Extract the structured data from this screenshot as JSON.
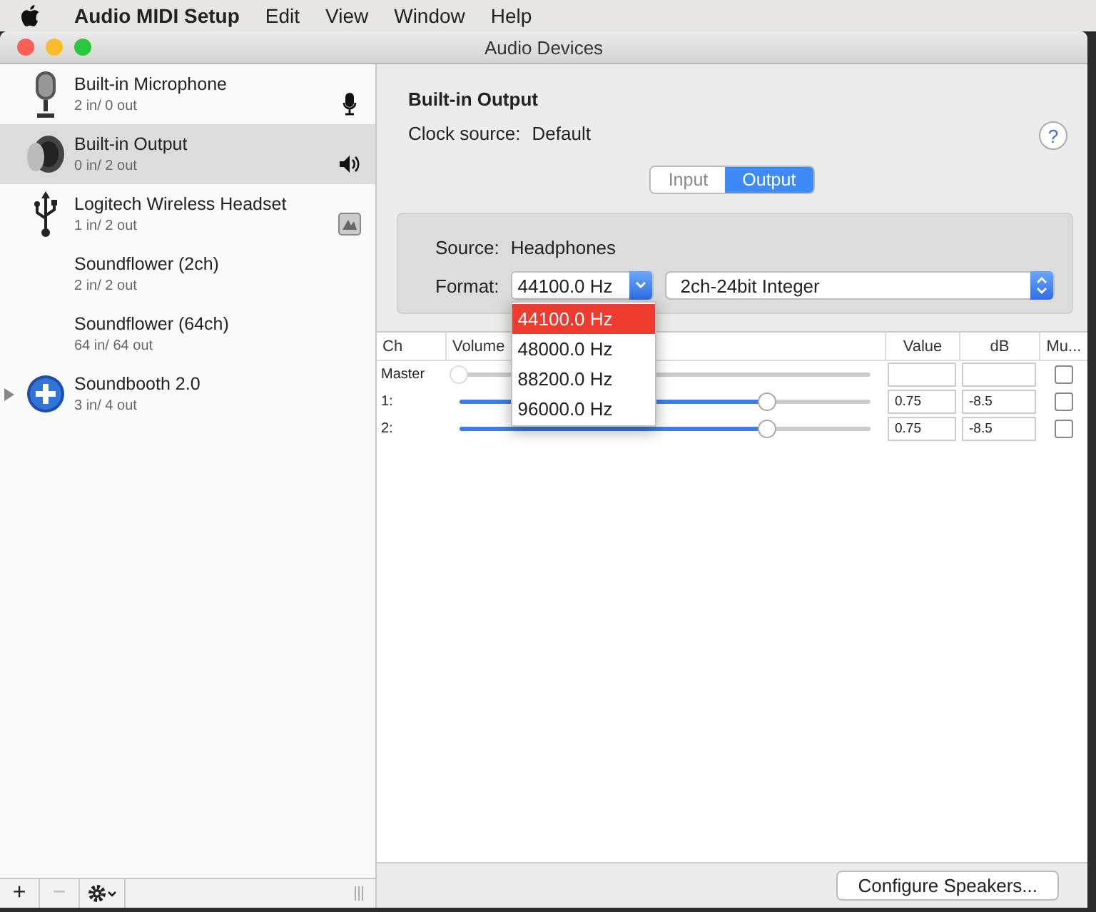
{
  "menu_bar": {
    "app": "Audio MIDI Setup",
    "items": [
      "Edit",
      "View",
      "Window",
      "Help"
    ]
  },
  "window": {
    "title": "Audio Devices"
  },
  "devices": [
    {
      "name": "Built-in Microphone",
      "io": "2 in/ 0 out",
      "selected": false,
      "expandable": false
    },
    {
      "name": "Built-in Output",
      "io": "0 in/ 2 out",
      "selected": true,
      "expandable": false
    },
    {
      "name": "Logitech Wireless Headset",
      "io": "1 in/ 2 out",
      "selected": false,
      "expandable": false
    },
    {
      "name": "Soundflower (2ch)",
      "io": "2 in/ 2 out",
      "selected": false,
      "expandable": false
    },
    {
      "name": "Soundflower (64ch)",
      "io": "64 in/ 64 out",
      "selected": false,
      "expandable": false
    },
    {
      "name": "Soundbooth 2.0",
      "io": "3 in/ 4 out",
      "selected": false,
      "expandable": true
    }
  ],
  "sidebar_buttons": [
    {
      "label": "+",
      "disabled": false
    },
    {
      "label": "−",
      "disabled": true
    }
  ],
  "detail": {
    "title": "Built-in Output",
    "clock_label": "Clock source:",
    "clock_value": "Default",
    "help": "?"
  },
  "tabs": [
    {
      "label": "Input",
      "selected": false
    },
    {
      "label": "Output",
      "selected": true
    }
  ],
  "source": {
    "label": "Source:",
    "value": "Headphones"
  },
  "format": {
    "label": "Format:",
    "rate": "44100.0 Hz",
    "sample_format": "2ch-24bit Integer"
  },
  "rate_options": [
    {
      "label": "44100.0 Hz",
      "selected": true
    },
    {
      "label": "48000.0 Hz",
      "selected": false
    },
    {
      "label": "88200.0 Hz",
      "selected": false
    },
    {
      "label": "96000.0 Hz",
      "selected": false
    }
  ],
  "table": {
    "columns": [
      "Ch",
      "Volume",
      "Value",
      "dB",
      "Mu..."
    ],
    "rows": [
      {
        "ch": "Master",
        "level": 0,
        "disabled": true,
        "value": "",
        "db": "",
        "muted": false
      },
      {
        "ch": "1:",
        "level": 0.75,
        "disabled": false,
        "value": "0.75",
        "db": "-8.5",
        "muted": false
      },
      {
        "ch": "2:",
        "level": 0.75,
        "disabled": false,
        "value": "0.75",
        "db": "-8.5",
        "muted": false
      }
    ]
  },
  "configure_button": "Configure Speakers..."
}
